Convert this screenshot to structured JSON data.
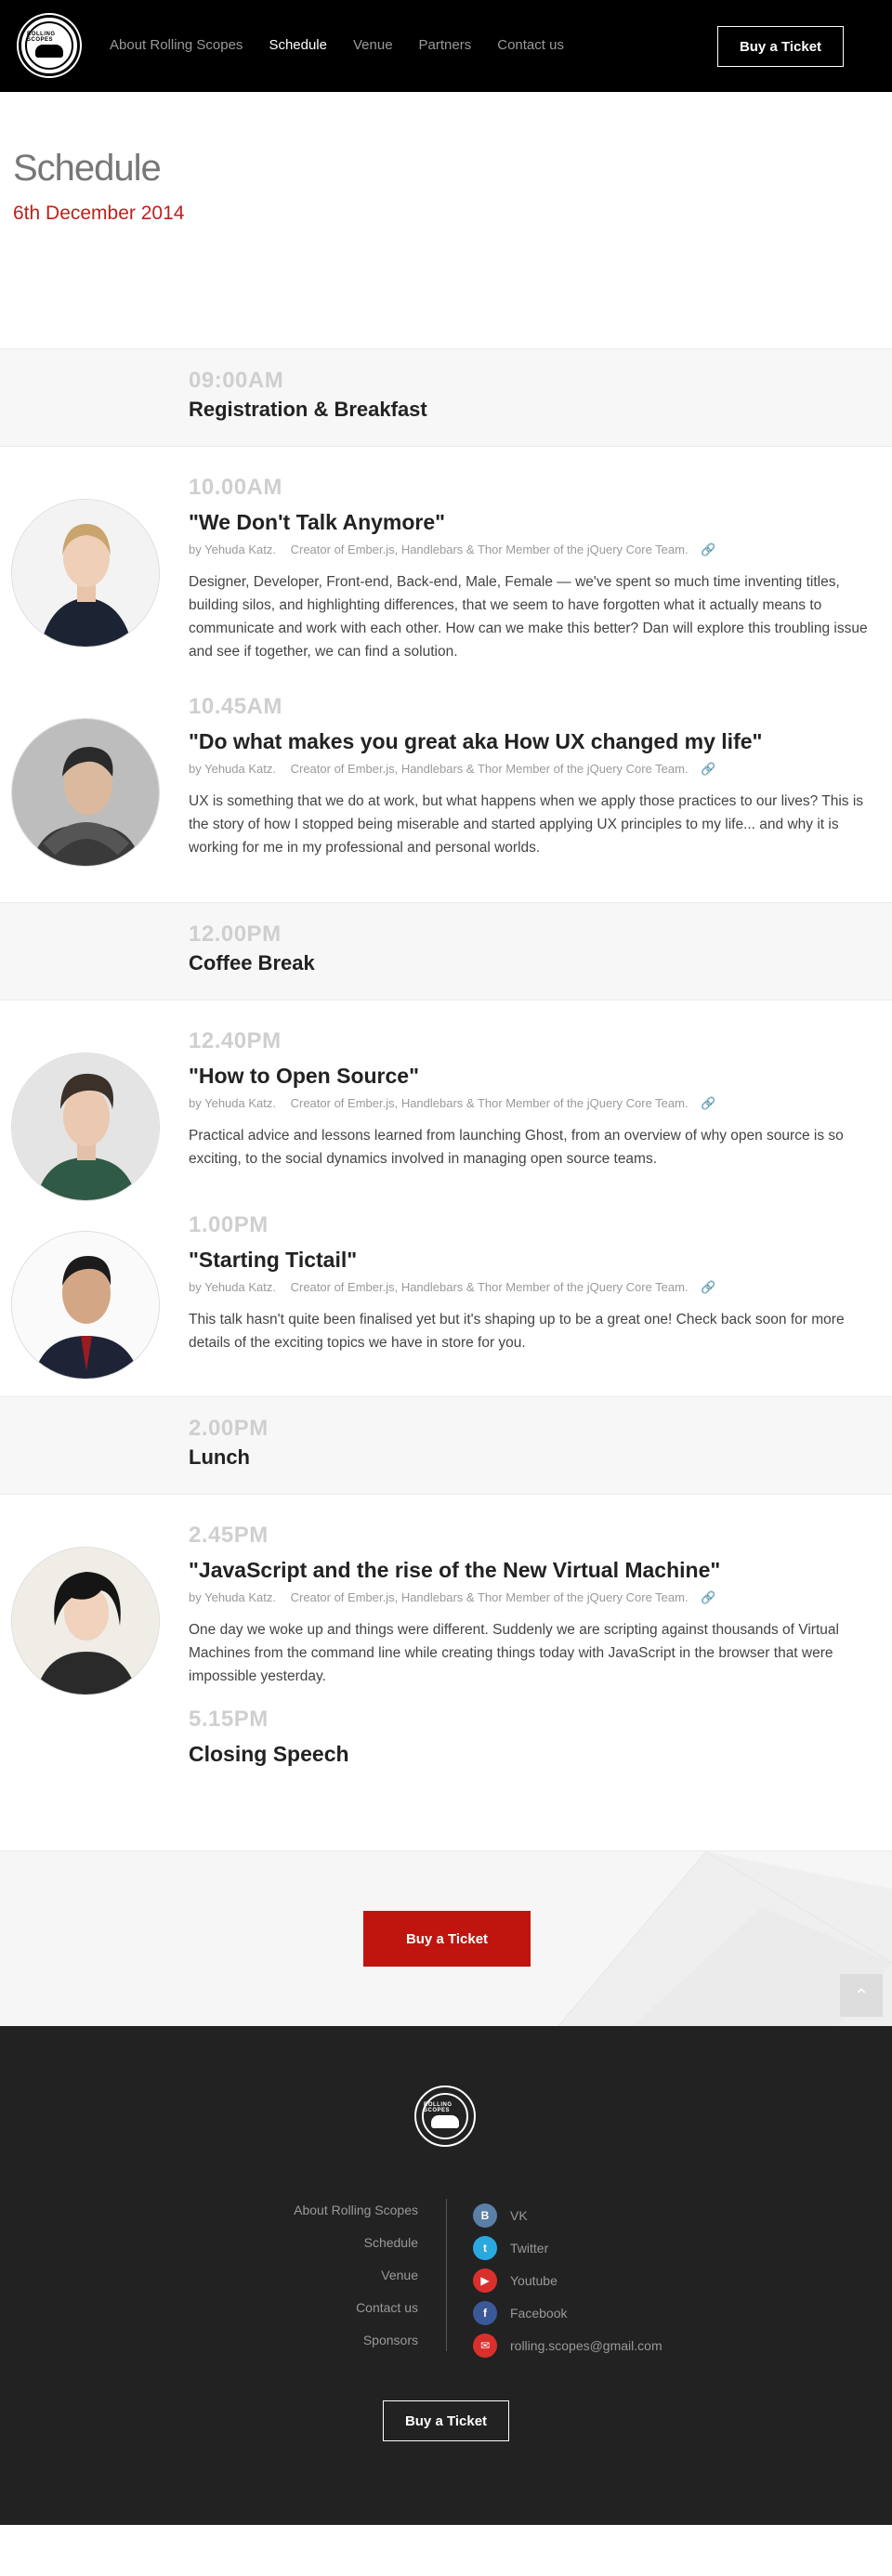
{
  "header": {
    "logo_text": "ROLLING SCOPES",
    "nav": [
      "About Rolling Scopes",
      "Schedule",
      "Venue",
      "Partners",
      "Contact us"
    ],
    "buy_label": "Buy a Ticket"
  },
  "page": {
    "title": "Schedule",
    "date": "6th December 2014"
  },
  "schedule": [
    {
      "type": "break",
      "time": "09:00AM",
      "title": "Registration & Breakfast"
    },
    {
      "type": "talk",
      "time": "10.00AM",
      "title": "\"We Don't Talk Anymore\"",
      "speaker": "by Yehuda Katz.",
      "role": "Creator of Ember.js, Handlebars & Thor Member of the jQuery Core Team.",
      "desc": "Designer, Developer, Front-end, Back-end, Male, Female — we've spent so much time inventing titles, building silos, and highlighting differences, that we seem to have forgotten what it actually means to communicate and work with each other. How can we make this better? Dan will explore this troubling issue and see if together, we can find a solution."
    },
    {
      "type": "talk",
      "time": "10.45AM",
      "title": "\"Do what makes you great aka How UX changed my life\"",
      "speaker": "by Yehuda Katz.",
      "role": "Creator of Ember.js, Handlebars & Thor Member of the jQuery Core Team.",
      "desc": "UX is something that we do at work, but what happens when we apply those practices to our lives? This is the story of how I stopped being miserable and started applying UX principles to my life... and why it is working for me in my professional and personal worlds."
    },
    {
      "type": "break",
      "time": "12.00PM",
      "title": "Coffee Break"
    },
    {
      "type": "talk",
      "time": "12.40PM",
      "title": "\"How to Open Source\"",
      "speaker": "by Yehuda Katz.",
      "role": "Creator of Ember.js, Handlebars & Thor Member of the jQuery Core Team.",
      "desc": "Practical advice and lessons learned from launching Ghost, from an overview of why open source is so exciting, to the social dynamics involved in managing open source teams."
    },
    {
      "type": "talk",
      "time": "1.00PM",
      "title": "\"Starting Tictail\"",
      "speaker": "by Yehuda Katz.",
      "role": "Creator of Ember.js, Handlebars & Thor Member of the jQuery Core Team.",
      "desc": "This talk hasn't quite been finalised yet but it's shaping up to be a great one! Check back soon for more details of the exciting topics we have in store for you."
    },
    {
      "type": "break",
      "time": "2.00PM",
      "title": "Lunch"
    },
    {
      "type": "talk",
      "time": "2.45PM",
      "title": "\"JavaScript and the rise of the New Virtual Machine\"",
      "speaker": "by Yehuda Katz.",
      "role": "Creator of Ember.js, Handlebars & Thor Member of the jQuery Core Team.",
      "desc": "One day we woke up and things were different. Suddenly we are scripting against thousands of Virtual Machines from the command line while creating things today with JavaScript in the browser that were impossible yesterday."
    },
    {
      "type": "closing",
      "time": "5.15PM",
      "title": "Closing Speech"
    }
  ],
  "buy_area": {
    "label": "Buy a Ticket"
  },
  "footer": {
    "links": [
      "About Rolling Scopes",
      "Schedule",
      "Venue",
      "Contact us",
      "Sponsors"
    ],
    "social": [
      {
        "icon": "vk-icon",
        "glyph": "B",
        "label": "VK",
        "color": "#5b7fa6"
      },
      {
        "icon": "twitter-icon",
        "glyph": "t",
        "label": "Twitter",
        "color": "#2aa9e0"
      },
      {
        "icon": "youtube-icon",
        "glyph": "▶",
        "label": "Youtube",
        "color": "#d9302b"
      },
      {
        "icon": "facebook-icon",
        "glyph": "f",
        "label": "Facebook",
        "color": "#3b5998"
      },
      {
        "icon": "email-icon",
        "glyph": "✉",
        "label": "rolling.scopes@gmail.com",
        "color": "#d9302b"
      }
    ],
    "buy_label": "Buy a Ticket"
  },
  "colors": {
    "accent": "#c0140f",
    "header_bg": "#000000",
    "footer_bg": "#222222",
    "break_bg": "#f7f7f7"
  }
}
